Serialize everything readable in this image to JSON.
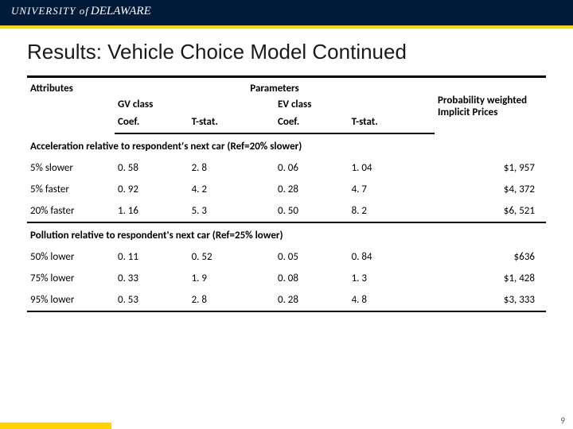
{
  "banner": {
    "university_of": "UNIVERSITY of",
    "delaware": "DELAWARE"
  },
  "title": "Results: Vehicle Choice Model Continued",
  "headers": {
    "attributes": "Attributes",
    "parameters": "Parameters",
    "gv_class": "GV class",
    "ev_class": "EV class",
    "coef": "Coef.",
    "tstat": "T-stat.",
    "prob_weighted": "Probability weighted Implicit Prices"
  },
  "sections": [
    {
      "title": "Acceleration  relative to respondent's next car (Ref=20% slower)",
      "rows": [
        {
          "attr": "5% slower",
          "gv_coef": "0. 58",
          "gv_t": "2. 8",
          "ev_coef": "0. 06",
          "ev_t": "1. 04",
          "price": "$1, 957"
        },
        {
          "attr": "5% faster",
          "gv_coef": "0. 92",
          "gv_t": "4. 2",
          "ev_coef": "0. 28",
          "ev_t": "4. 7",
          "price": "$4, 372"
        },
        {
          "attr": "20% faster",
          "gv_coef": "1. 16",
          "gv_t": "5. 3",
          "ev_coef": "0. 50",
          "ev_t": "8. 2",
          "price": "$6, 521"
        }
      ]
    },
    {
      "title": "Pollution relative to respondent's next car (Ref=25% lower)",
      "rows": [
        {
          "attr": "50% lower",
          "gv_coef": "0. 11",
          "gv_t": "0. 52",
          "ev_coef": "0. 05",
          "ev_t": "0. 84",
          "price": "$636"
        },
        {
          "attr": "75% lower",
          "gv_coef": "0. 33",
          "gv_t": "1. 9",
          "ev_coef": "0. 08",
          "ev_t": "1. 3",
          "price": "$1, 428"
        },
        {
          "attr": "95% lower",
          "gv_coef": "0. 53",
          "gv_t": "2. 8",
          "ev_coef": "0. 28",
          "ev_t": "4. 8",
          "price": "$3, 333"
        }
      ]
    }
  ],
  "page_number": "9",
  "chart_data": {
    "type": "table",
    "title": "Vehicle Choice Model — Parameters and Implicit Prices",
    "columns": [
      "Attribute",
      "GV Coef.",
      "GV T-stat.",
      "EV Coef.",
      "EV T-stat.",
      "Probability weighted Implicit Prices"
    ],
    "groups": [
      {
        "label": "Acceleration relative to respondent's next car (Ref=20% slower)",
        "rows": [
          [
            "5% slower",
            0.58,
            2.8,
            0.06,
            1.04,
            1957
          ],
          [
            "5% faster",
            0.92,
            4.2,
            0.28,
            4.7,
            4372
          ],
          [
            "20% faster",
            1.16,
            5.3,
            0.5,
            8.2,
            6521
          ]
        ]
      },
      {
        "label": "Pollution relative to respondent's next car (Ref=25% lower)",
        "rows": [
          [
            "50% lower",
            0.11,
            0.52,
            0.05,
            0.84,
            636
          ],
          [
            "75% lower",
            0.33,
            1.9,
            0.08,
            1.3,
            1428
          ],
          [
            "95% lower",
            0.53,
            2.8,
            0.28,
            4.8,
            3333
          ]
        ]
      }
    ]
  }
}
